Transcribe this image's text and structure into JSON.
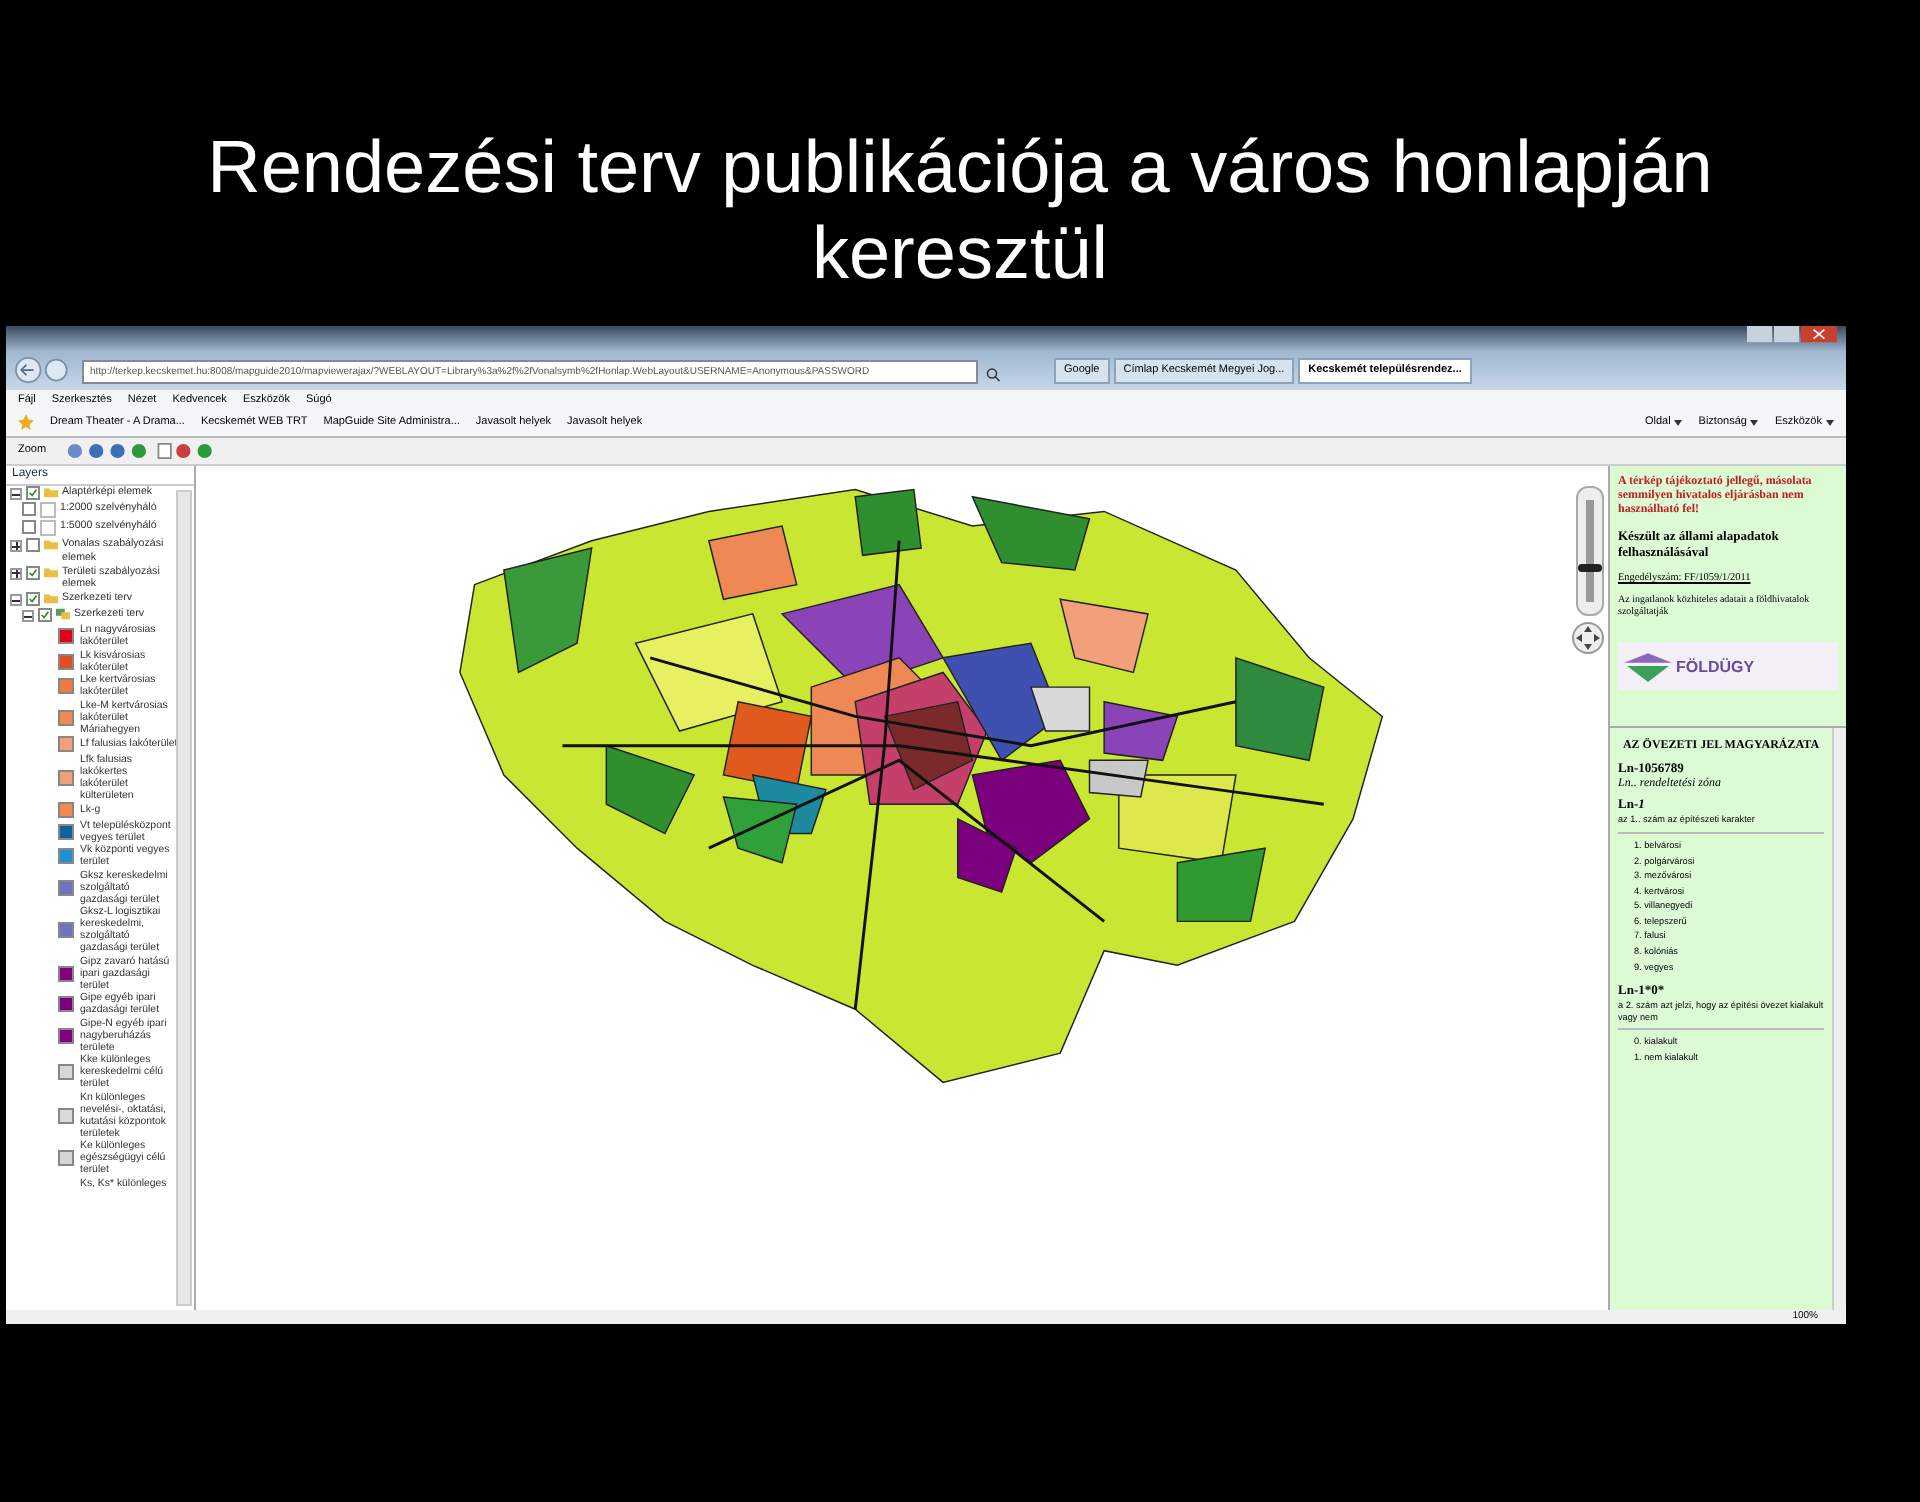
{
  "slide_title": "Rendezési terv publikációja a város honlapján keresztül",
  "browser": {
    "url": "http://terkep.kecskemet.hu:8008/mapguide2010/mapviewerajax/?WEBLAYOUT=Library%3a%2f%2fVonalsymb%2fHonlap.WebLayout&USERNAME=Anonymous&PASSWORD",
    "tabs": [
      {
        "label": "Google",
        "selected": false
      },
      {
        "label": "Címlap Kecskemét Megyei Jog...",
        "selected": false
      },
      {
        "label": "Kecskemét településrendez...",
        "selected": true
      }
    ],
    "menu": [
      "Fájl",
      "Szerkesztés",
      "Nézet",
      "Kedvencek",
      "Eszközök",
      "Súgó"
    ],
    "favorites": [
      "Dream Theater - A Drama...",
      "Kecskemét WEB TRT",
      "MapGuide Site Administra...",
      "Javasolt helyek",
      "Javasolt helyek"
    ],
    "commands": [
      "Oldal",
      "Biztonság",
      "Eszközök"
    ],
    "zoom_status": "100%"
  },
  "toolbar": {
    "zoom_label": "Zoom"
  },
  "layers": {
    "title": "Layers",
    "items": [
      {
        "label": "Alaptérképi elemek",
        "checked": true,
        "expanded": true,
        "children": [
          {
            "label": "1:2000 szelvényháló",
            "checked": false
          },
          {
            "label": "1:5000 szelvényháló",
            "checked": false
          }
        ]
      },
      {
        "label": "Vonalas szabályozási elemek",
        "checked": false,
        "expanded": false
      },
      {
        "label": "Területi szabályozási elemek",
        "checked": true,
        "expanded": false
      },
      {
        "label": "Szerkezeti terv",
        "checked": true,
        "expanded": true,
        "children": [
          {
            "label": "Szerkezeti terv",
            "checked": true,
            "expanded": true,
            "legend": [
              {
                "label": "Ln nagyvárosias lakóterület",
                "color": "#e0001a"
              },
              {
                "label": "Lk kisvárosias lakóterület",
                "color": "#e0501e"
              },
              {
                "label": "Lke kertvárosias lakóterület",
                "color": "#f07a40"
              },
              {
                "label": "Lke-M kertvárosias lakóterület Máriahegyen",
                "color": "#f08a50"
              },
              {
                "label": "Lf falusias lakóterület",
                "color": "#f2a07c"
              },
              {
                "label": "Lfk falusias lakókertes lakóterület külterületen",
                "color": "#f0a07a"
              },
              {
                "label": "Lk-g",
                "color": "#f08a50"
              },
              {
                "label": "Vt településközpont vegyes terület",
                "color": "#10609e"
              },
              {
                "label": "Vk központi vegyes terület",
                "color": "#2090d0"
              },
              {
                "label": "Gksz kereskedelmi szolgáltató gazdasági terület",
                "color": "#7070c0"
              },
              {
                "label": "Gksz-L logisztikai kereskedelmi, szolgáltató gazdasági terület",
                "color": "#7272c2"
              },
              {
                "label": "Gipz zavaró hatású ipari gazdasági terület",
                "color": "#800080"
              },
              {
                "label": "Gipe egyéb ipari gazdasági terület",
                "color": "#7a007e"
              },
              {
                "label": "Gipe-N egyéb ipari nagyberuházás területe",
                "color": "#820082"
              },
              {
                "label": "Kke különleges kereskedelmi célú terület",
                "color": "#d8d8d8"
              },
              {
                "label": "Kn különleges nevelési-, oktatási, kutatási központok területek",
                "color": "#dadada"
              },
              {
                "label": "Ke különleges egészségügyi célú terület",
                "color": "#d6d6d6"
              },
              {
                "label": "Ks, Ks* különleges"
              }
            ]
          }
        ]
      }
    ]
  },
  "zoom_slider": {
    "level": 0.35
  },
  "info": {
    "warning": "A térkép tájékoztató jellegű, másolata semmilyen hivatalos eljárásban nem használható fel!",
    "source": "Készült az állami alapadatok felhasználásával",
    "license": "Engedélyszám: FF/1059/1/2011",
    "note": "Az ingatlanok közhiteles adatait a földhivatalok szolgáltatják",
    "logo_text": "FÖLDÜGY",
    "heading": "AZ ÖVEZETI JEL MAGYARÁZATA",
    "code": "Ln-1056789",
    "code_caption": "Ln.. rendeltetési zóna",
    "sections": [
      {
        "code": "Ln-*1*",
        "desc": "az 1.. szám az építészeti karakter",
        "items": [
          "1. belvárosi",
          "2. polgárvárosi",
          "3. mezővárosi",
          "4. kertvárosi",
          "5. villanegyedi",
          "6. telepszerű",
          "7. falusi",
          "8. kolóniás",
          "9. vegyes"
        ]
      },
      {
        "code": "Ln-1*0*",
        "desc": "a 2. szám azt jelzi, hogy az építési övezet kialakult vagy nem",
        "items": [
          "0. kialakult",
          "1. nem kialakult"
        ]
      }
    ]
  }
}
